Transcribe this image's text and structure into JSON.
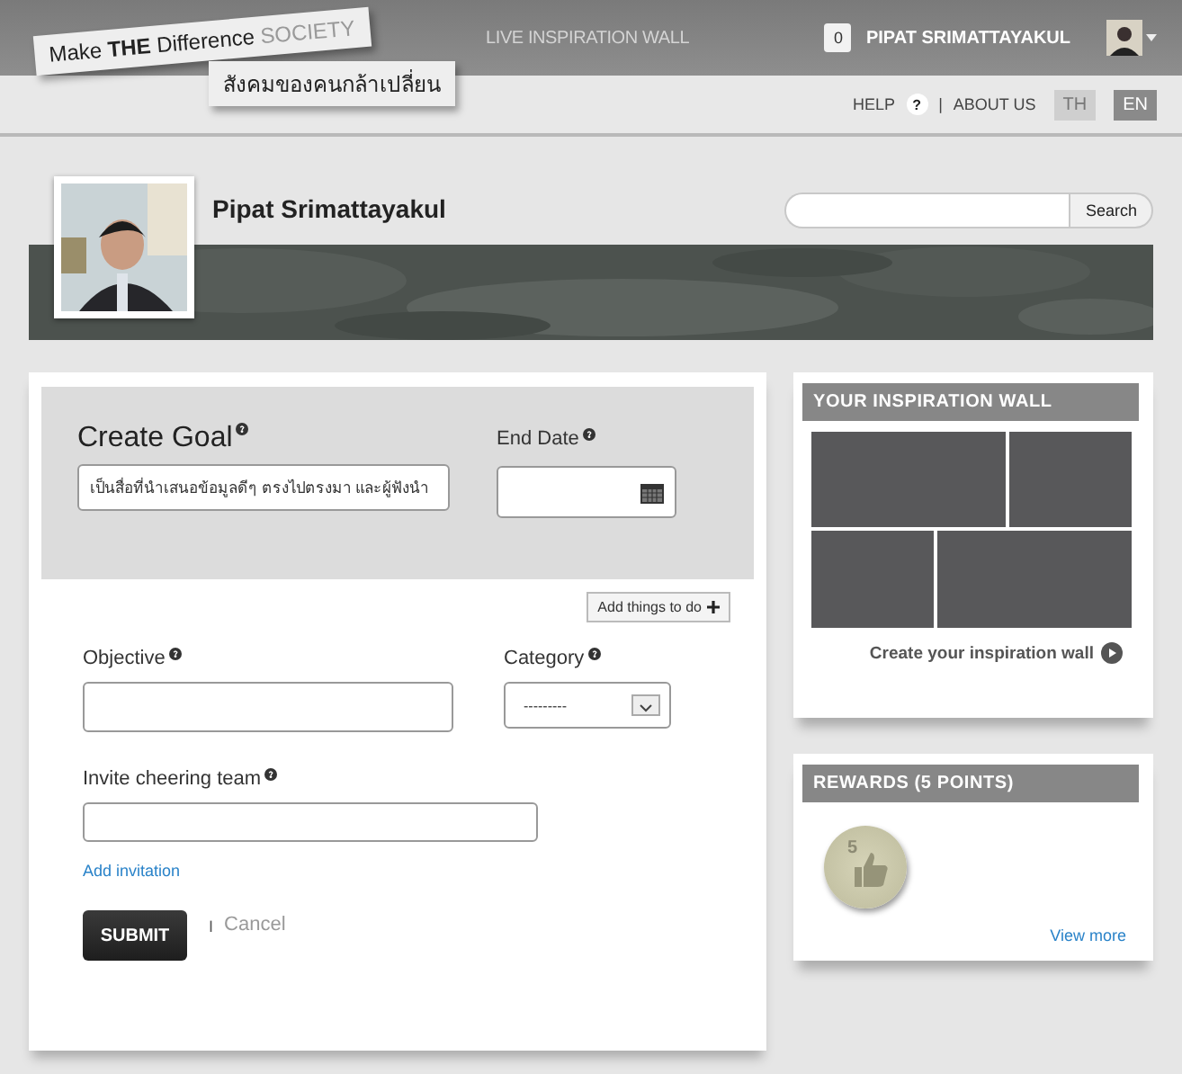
{
  "logo": {
    "line1": "Make **THE** Difference",
    "accent": "SOCIETY",
    "line2": "สังคมของคนกล้าเปลี่ยน"
  },
  "header": {
    "nav_link": "LIVE INSPIRATION WALL",
    "notification_count": "0",
    "user_name": "PIPAT SRIMATTAYAKUL"
  },
  "subbar": {
    "help": "HELP",
    "help_icon": "?",
    "separator": "|",
    "about": "ABOUT US",
    "languages": [
      {
        "label": "TH",
        "selected": false
      },
      {
        "label": "EN",
        "selected": true
      }
    ]
  },
  "profile": {
    "name": "Pipat Srimattayakul",
    "search_button": "Search"
  },
  "form": {
    "title": "Create Goal",
    "goal_value": "เป็นสื่อที่นำเสนอข้อมูลดีๆ ตรงไปตรงมา และผู้ฟังนำ",
    "end_date_label": "End Date",
    "add_things": "Add things to do",
    "objective_label": "Objective",
    "category_label": "Category",
    "category_value": "---------",
    "invite_label": "Invite cheering team",
    "add_invitation": "Add invitation",
    "submit": "SUBMIT",
    "cancel_separator": "I",
    "cancel": "Cancel"
  },
  "inspiration_wall": {
    "title": "YOUR INSPIRATION WALL",
    "link": "Create your inspiration wall"
  },
  "rewards": {
    "title": "REWARDS (5 POINTS)",
    "badge_number": "5",
    "view_more": "View more"
  }
}
